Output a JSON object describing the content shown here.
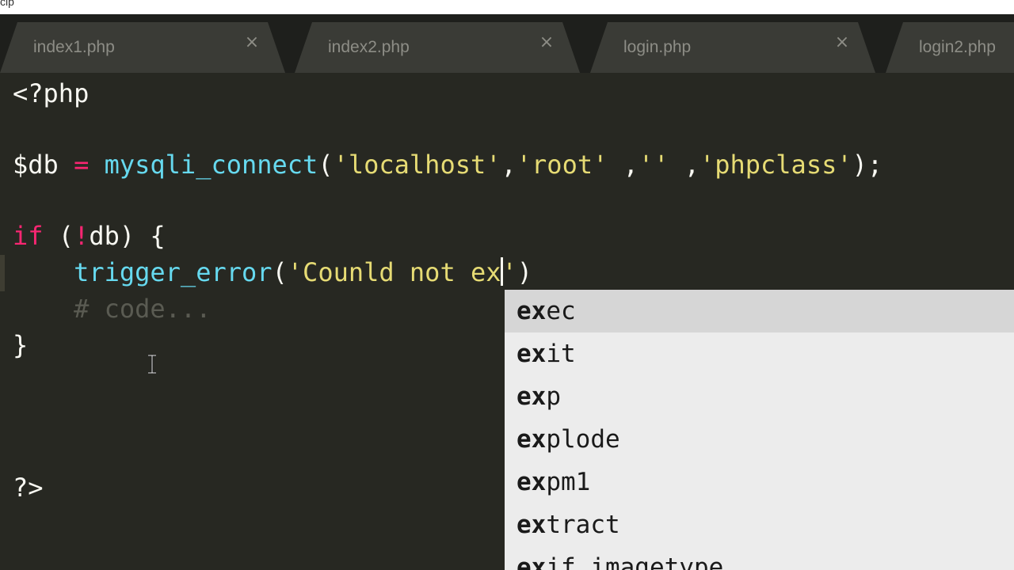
{
  "window": {
    "title_fragment": "cip"
  },
  "tabs": [
    {
      "label": "index1.php",
      "close": "×"
    },
    {
      "label": "index2.php",
      "close": "×"
    },
    {
      "label": "login.php",
      "close": "×"
    },
    {
      "label": "login2.php",
      "close": ""
    }
  ],
  "editor": {
    "lines": {
      "l1": "<?php",
      "l2_var": "$db",
      "l2_eq": " = ",
      "l2_fn": "mysqli_connect",
      "l2_open": "(",
      "l2_s1": "'localhost'",
      "l2_c1": ",",
      "l2_s2": "'root'",
      "l2_c2": " ,",
      "l2_s3": "''",
      "l2_c3": " ,",
      "l2_s4": "'phpclass'",
      "l2_end": ");",
      "l3_kw": "if",
      "l3_open": " (",
      "l3_not": "!",
      "l3_rest": "db) {",
      "l4_indent": "    ",
      "l4_fn": "trigger_error",
      "l4_open": "(",
      "l4_str": "'Counld not ex",
      "l4_str_end": "'",
      "l4_close": ")",
      "l5_comment": "    # code...",
      "l6": "}",
      "l7": "?>"
    }
  },
  "autocomplete": {
    "typed_prefix": "ex",
    "items": [
      {
        "prefix": "ex",
        "rest": "ec"
      },
      {
        "prefix": "ex",
        "rest": "it"
      },
      {
        "prefix": "ex",
        "rest": "p"
      },
      {
        "prefix": "ex",
        "rest": "plode"
      },
      {
        "prefix": "ex",
        "rest": "pm1"
      },
      {
        "prefix": "ex",
        "rest": "tract"
      },
      {
        "prefix": "ex",
        "rest": "if_imagetype"
      }
    ],
    "selected_index": 0
  },
  "colors": {
    "background": "#272822",
    "keyword": "#f92672",
    "function": "#66d9ef",
    "string": "#e6db74",
    "comment": "#5a5b52",
    "text": "#f8f8f2",
    "popup": "#ececec"
  }
}
